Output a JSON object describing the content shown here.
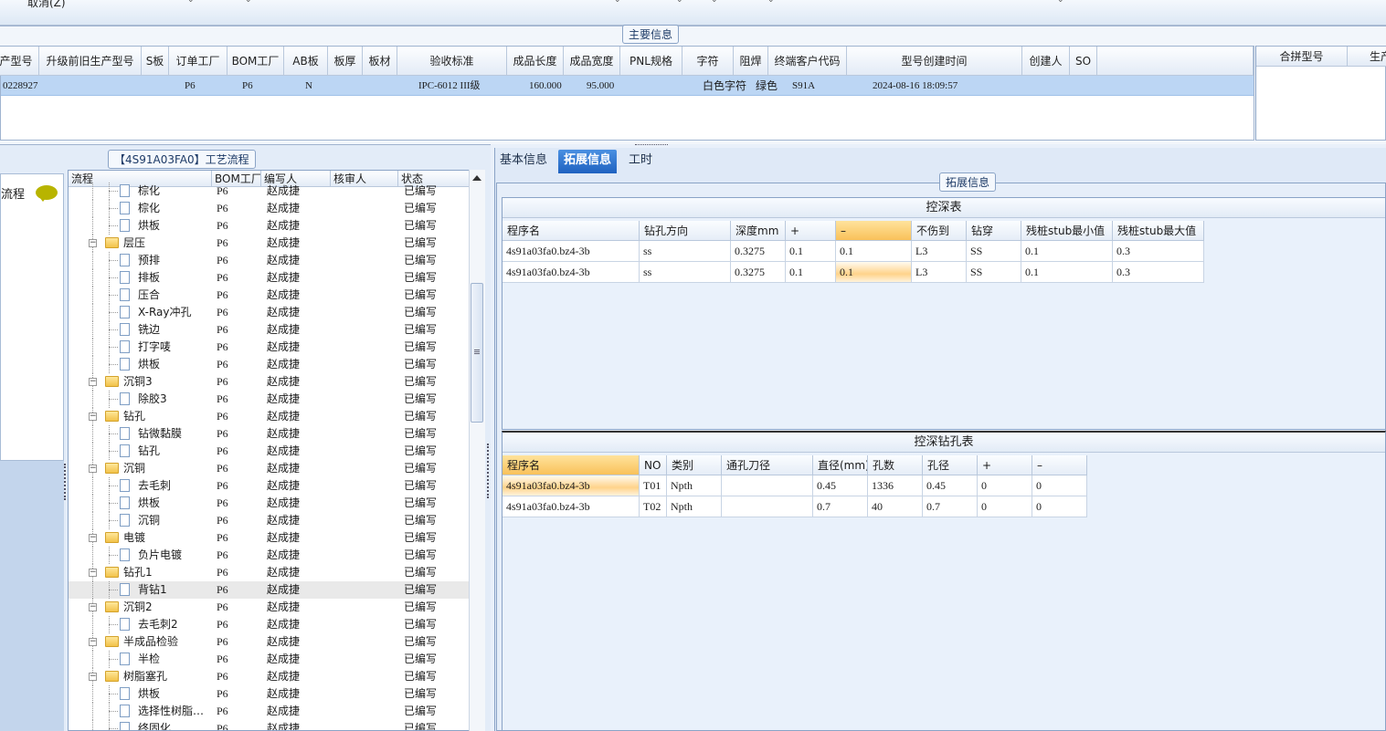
{
  "toolbar": {
    "cancel_label": "取消(Z)"
  },
  "main_info": {
    "title": "主要信息",
    "columns": [
      "产型号",
      "升级前旧生产型号",
      "S板",
      "订单工厂",
      "BOM工厂",
      "AB板",
      "板厚",
      "板材",
      "验收标准",
      "成品长度",
      "成品宽度",
      "PNL规格",
      "字符",
      "阻焊",
      "终端客户代码",
      "型号创建时间",
      "创建人",
      "SO"
    ],
    "row": {
      "model_no": "0228927",
      "order_factory": "P6",
      "bom_factory": "P6",
      "ab_board": "N",
      "acceptance": "IPC-6012 III级",
      "length": "160.000",
      "width": "95.000",
      "char": "白色字符",
      "solder_mask": "绿色",
      "customer_code": "S91A",
      "created_time": "2024-08-16 18:09:57"
    },
    "right_columns": [
      "合拼型号",
      "生产"
    ]
  },
  "process": {
    "title": "【4S91A03FA0】工艺流程",
    "side_label": "流程",
    "columns": [
      "流程",
      "BOM工厂",
      "编写人",
      "核审人",
      "状态"
    ],
    "rows": [
      {
        "level": 1,
        "name": "棕化",
        "factory": "P6",
        "writer": "赵成捷",
        "status": "已编写",
        "partial": true
      },
      {
        "level": 1,
        "name": "棕化",
        "factory": "P6",
        "writer": "赵成捷",
        "status": "已编写"
      },
      {
        "level": 1,
        "name": "烘板",
        "factory": "P6",
        "writer": "赵成捷",
        "status": "已编写"
      },
      {
        "level": 0,
        "name": "层压",
        "factory": "P6",
        "writer": "赵成捷",
        "status": "已编写"
      },
      {
        "level": 1,
        "name": "预排",
        "factory": "P6",
        "writer": "赵成捷",
        "status": "已编写"
      },
      {
        "level": 1,
        "name": "排板",
        "factory": "P6",
        "writer": "赵成捷",
        "status": "已编写"
      },
      {
        "level": 1,
        "name": "压合",
        "factory": "P6",
        "writer": "赵成捷",
        "status": "已编写"
      },
      {
        "level": 1,
        "name": "X-Ray冲孔",
        "factory": "P6",
        "writer": "赵成捷",
        "status": "已编写"
      },
      {
        "level": 1,
        "name": "铣边",
        "factory": "P6",
        "writer": "赵成捷",
        "status": "已编写"
      },
      {
        "level": 1,
        "name": "打字唛",
        "factory": "P6",
        "writer": "赵成捷",
        "status": "已编写"
      },
      {
        "level": 1,
        "name": "烘板",
        "factory": "P6",
        "writer": "赵成捷",
        "status": "已编写"
      },
      {
        "level": 0,
        "name": "沉铜3",
        "factory": "P6",
        "writer": "赵成捷",
        "status": "已编写"
      },
      {
        "level": 1,
        "name": "除胶3",
        "factory": "P6",
        "writer": "赵成捷",
        "status": "已编写"
      },
      {
        "level": 0,
        "name": "钻孔",
        "factory": "P6",
        "writer": "赵成捷",
        "status": "已编写"
      },
      {
        "level": 1,
        "name": "钻微黏膜",
        "factory": "P6",
        "writer": "赵成捷",
        "status": "已编写"
      },
      {
        "level": 1,
        "name": "钻孔",
        "factory": "P6",
        "writer": "赵成捷",
        "status": "已编写"
      },
      {
        "level": 0,
        "name": "沉铜",
        "factory": "P6",
        "writer": "赵成捷",
        "status": "已编写"
      },
      {
        "level": 1,
        "name": "去毛刺",
        "factory": "P6",
        "writer": "赵成捷",
        "status": "已编写"
      },
      {
        "level": 1,
        "name": "烘板",
        "factory": "P6",
        "writer": "赵成捷",
        "status": "已编写"
      },
      {
        "level": 1,
        "name": "沉铜",
        "factory": "P6",
        "writer": "赵成捷",
        "status": "已编写"
      },
      {
        "level": 0,
        "name": "电镀",
        "factory": "P6",
        "writer": "赵成捷",
        "status": "已编写"
      },
      {
        "level": 1,
        "name": "负片电镀",
        "factory": "P6",
        "writer": "赵成捷",
        "status": "已编写"
      },
      {
        "level": 0,
        "name": "钻孔1",
        "factory": "P6",
        "writer": "赵成捷",
        "status": "已编写"
      },
      {
        "level": 1,
        "name": "背钻1",
        "factory": "P6",
        "writer": "赵成捷",
        "status": "已编写",
        "selected": true
      },
      {
        "level": 0,
        "name": "沉铜2",
        "factory": "P6",
        "writer": "赵成捷",
        "status": "已编写"
      },
      {
        "level": 1,
        "name": "去毛刺2",
        "factory": "P6",
        "writer": "赵成捷",
        "status": "已编写"
      },
      {
        "level": 0,
        "name": "半成品检验",
        "factory": "P6",
        "writer": "赵成捷",
        "status": "已编写"
      },
      {
        "level": 1,
        "name": "半检",
        "factory": "P6",
        "writer": "赵成捷",
        "status": "已编写"
      },
      {
        "level": 0,
        "name": "树脂塞孔",
        "factory": "P6",
        "writer": "赵成捷",
        "status": "已编写"
      },
      {
        "level": 1,
        "name": "烘板",
        "factory": "P6",
        "writer": "赵成捷",
        "status": "已编写"
      },
      {
        "level": 1,
        "name": "选择性树脂…",
        "factory": "P6",
        "writer": "赵成捷",
        "status": "已编写"
      },
      {
        "level": 1,
        "name": "终固化",
        "factory": "P6",
        "writer": "赵成捷",
        "status": "已编写"
      }
    ]
  },
  "tabs": [
    "基本信息",
    "拓展信息",
    "工时"
  ],
  "active_tab": "拓展信息",
  "ext": {
    "title": "拓展信息",
    "depth_table": {
      "title": "控深表",
      "columns": [
        "程序名",
        "钻孔方向",
        "深度mm",
        "+",
        "–",
        "不伤到",
        "钻穿",
        "残桩stub最小值",
        "残桩stub最大值"
      ],
      "rows": [
        [
          "4s91a03fa0.bz4-3b",
          "ss",
          "0.3275",
          "0.1",
          "0.1",
          "L3",
          "SS",
          "0.1",
          "0.3"
        ],
        [
          "4s91a03fa0.bz4-3b",
          "ss",
          "0.3275",
          "0.1",
          "0.1",
          "L3",
          "SS",
          "0.1",
          "0.3"
        ]
      ]
    },
    "drill_table": {
      "title": "控深钻孔表",
      "columns": [
        "程序名",
        "NO",
        "类别",
        "通孔刀径",
        "直径(mm)",
        "孔数",
        "孔径",
        "+",
        "–"
      ],
      "rows": [
        [
          "4s91a03fa0.bz4-3b",
          "T01",
          "Npth",
          "",
          "0.45",
          "1336",
          "0.45",
          "0",
          "0"
        ],
        [
          "4s91a03fa0.bz4-3b",
          "T02",
          "Npth",
          "",
          "0.7",
          "40",
          "0.7",
          "0",
          "0"
        ]
      ]
    }
  }
}
